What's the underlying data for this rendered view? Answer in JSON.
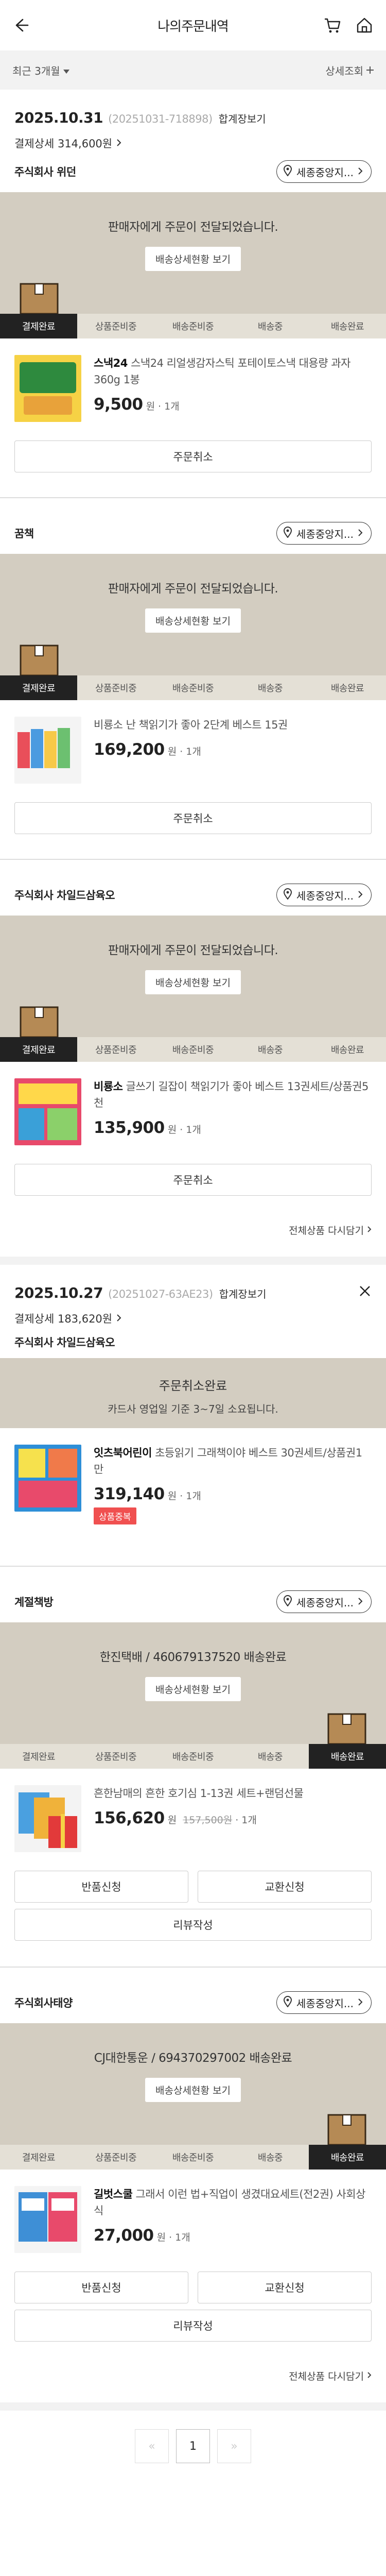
{
  "header": {
    "title": "나의주문내역"
  },
  "filter": {
    "period": "최근 3개월",
    "search": "상세조회"
  },
  "orders": [
    {
      "date": "2025.10.31",
      "order_no": "(20251031-718898)",
      "detail_link": "합계장보기",
      "payment": "결제상세 314,600원",
      "sellers": [
        {
          "name": "주식회사 위던",
          "pill": "세종중앙지...",
          "status_msg": "판매자에게 주문이 전달되었습니다.",
          "status_btn": "배송상세현황 보기",
          "steps": [
            "결제완료",
            "상품준비중",
            "배송준비중",
            "배송중",
            "배송완료"
          ],
          "product": {
            "brand": "스낵24",
            "title": "스낵24 리얼생감자스틱 포테이토스낵 대용량 과자 360g 1봉",
            "price": "9,500",
            "unit": "원",
            "qty": "1개"
          },
          "button": "주문취소"
        },
        {
          "name": "꿈책",
          "pill": "세종중앙지...",
          "status_msg": "판매자에게 주문이 전달되었습니다.",
          "status_btn": "배송상세현황 보기",
          "steps": [
            "결제완료",
            "상품준비중",
            "배송준비중",
            "배송중",
            "배송완료"
          ],
          "product": {
            "brand": "",
            "title": "비룡소 난 책읽기가 좋아 2단계 베스트 15권",
            "price": "169,200",
            "unit": "원",
            "qty": "1개"
          },
          "button": "주문취소"
        },
        {
          "name": "주식회사 차일드삼육오",
          "pill": "세종중앙지...",
          "status_msg": "판매자에게 주문이 전달되었습니다.",
          "status_btn": "배송상세현황 보기",
          "steps": [
            "결제완료",
            "상품준비중",
            "배송준비중",
            "배송중",
            "배송완료"
          ],
          "product": {
            "brand": "비룡소",
            "title": "글쓰기 길잡이 책읽기가 좋아 베스트 13권세트/상품권5천",
            "price": "135,900",
            "unit": "원",
            "qty": "1개"
          },
          "button": "주문취소"
        }
      ],
      "reorder": "전체상품 다시담기"
    },
    {
      "date": "2025.10.27",
      "order_no": "(20251027-63AE23)",
      "detail_link": "합계장보기",
      "payment": "결제상세 183,620원",
      "cancel_seller": "주식회사 차일드삼육오",
      "cancel_msg1": "주문취소완료",
      "cancel_msg2": "카드사 영업일 기준 3~7일 소요됩니다.",
      "cancel_product": {
        "brand": "잇츠북어린이",
        "title": "초등읽기 그래책이야 베스트 30권세트/상품권1만",
        "price": "319,140",
        "unit": "원",
        "qty": "1개",
        "badge": "상품중복"
      },
      "sellers": [
        {
          "name": "계절책방",
          "pill": "세종중앙지...",
          "status_msg": "한진택배 / 460679137520 배송완료",
          "status_btn": "배송상세현황 보기",
          "steps": [
            "결제완료",
            "상품준비중",
            "배송준비중",
            "배송중",
            "배송완료"
          ],
          "product": {
            "brand": "",
            "title": "흔한남매의 흔한 호기심 1-13권 세트+랜덤선물",
            "price": "156,620",
            "unit": "원",
            "orig": "157,500원",
            "qty": "1개"
          },
          "buttons": [
            "반품신청",
            "교환신청",
            "리뷰작성"
          ]
        },
        {
          "name": "주식회사태양",
          "pill": "세종중앙지...",
          "status_msg": "CJ대한통운 / 694370297002 배송완료",
          "status_btn": "배송상세현황 보기",
          "steps": [
            "결제완료",
            "상품준비중",
            "배송준비중",
            "배송중",
            "배송완료"
          ],
          "product": {
            "brand": "길벗스쿨",
            "title": "그래서 이런 법+직업이 생겼대요세트(전2권) 사회상식",
            "price": "27,000",
            "unit": "원",
            "qty": "1개"
          },
          "buttons": [
            "반품신청",
            "교환신청",
            "리뷰작성"
          ]
        }
      ],
      "reorder": "전체상품 다시담기"
    }
  ],
  "pager": {
    "prev": "«",
    "page": "1",
    "next": "»"
  },
  "colors": {
    "status_bg": "#d3cdc1",
    "steps_bg": "#e4e0d6",
    "active_step": "#222222",
    "badge": "#f05050"
  }
}
